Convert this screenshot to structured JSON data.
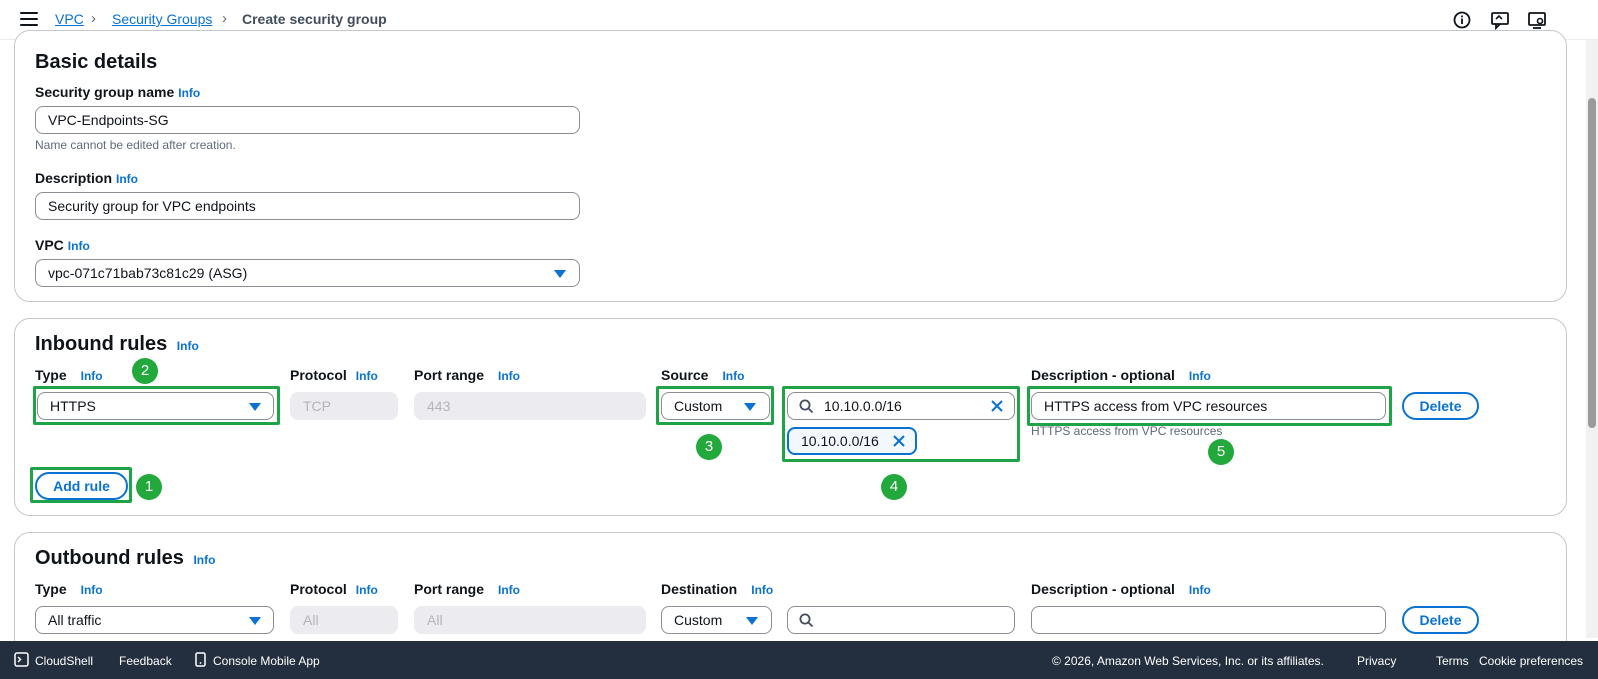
{
  "breadcrumb": {
    "vpc": "VPC",
    "security_groups": "Security Groups",
    "current": "Create security group"
  },
  "basic_details": {
    "title": "Basic details",
    "name_label": "Security group name",
    "name_value": "VPC-Endpoints-SG",
    "name_hint": "Name cannot be edited after creation.",
    "description_label": "Description",
    "description_value": "Security group for VPC endpoints",
    "vpc_label": "VPC",
    "vpc_value": "vpc-071c71bab73c81c29 (ASG)"
  },
  "info_link": "Info",
  "inbound": {
    "title": "Inbound rules",
    "col_type": "Type",
    "col_protocol": "Protocol",
    "col_port_range": "Port range",
    "col_source": "Source",
    "col_description": "Description - optional",
    "rule": {
      "type": "HTTPS",
      "protocol": "TCP",
      "port_range": "443",
      "source_mode": "Custom",
      "source_search": "10.10.0.0/16",
      "source_token": "10.10.0.0/16",
      "description": "HTTPS access from VPC resources",
      "description_hint": "HTTPS access from VPC resources"
    },
    "delete_label": "Delete",
    "add_rule_label": "Add rule"
  },
  "outbound": {
    "title": "Outbound rules",
    "col_type": "Type",
    "col_protocol": "Protocol",
    "col_port_range": "Port range",
    "col_destination": "Destination",
    "col_description": "Description - optional",
    "rule": {
      "type": "All traffic",
      "protocol": "All",
      "port_range": "All",
      "destination_mode": "Custom",
      "destination_search": "",
      "description": ""
    },
    "delete_label": "Delete"
  },
  "annotations": [
    "1",
    "2",
    "3",
    "4",
    "5"
  ],
  "footer": {
    "cloudshell": "CloudShell",
    "feedback": "Feedback",
    "console_mobile": "Console Mobile App",
    "copyright": "© 2026, Amazon Web Services, Inc. or its affiliates.",
    "privacy": "Privacy",
    "terms": "Terms",
    "cookie": "Cookie preferences"
  },
  "colors": {
    "accent": "#0972d3",
    "annotation_green": "#22a83b",
    "footer_bg": "#232f3e"
  },
  "icons": [
    "menu-icon",
    "info-circle-icon",
    "feedback-icon",
    "settings-icon",
    "search-icon",
    "close-icon",
    "caret-down-icon",
    "cloudshell-icon",
    "mobile-icon"
  ]
}
